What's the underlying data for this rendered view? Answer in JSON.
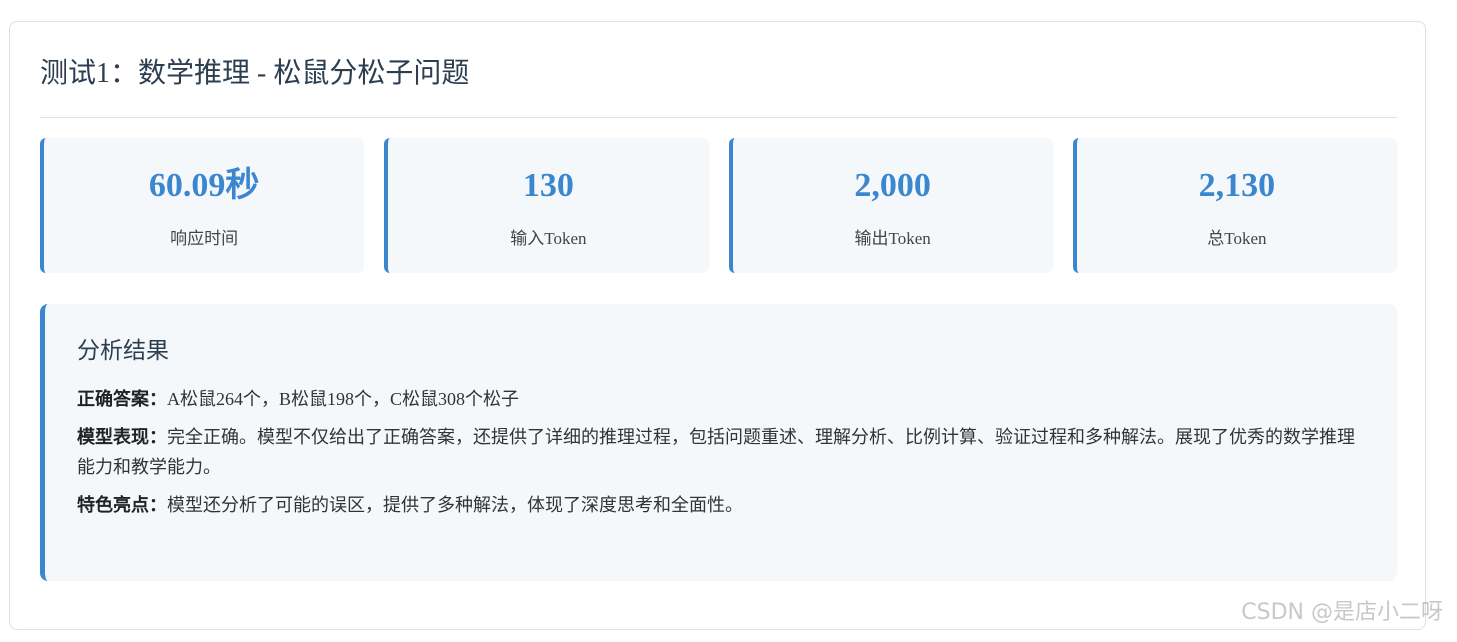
{
  "test": {
    "title": "测试1：数学推理 - 松鼠分松子问题"
  },
  "stats": [
    {
      "value": "60.09秒",
      "label": "响应时间"
    },
    {
      "value": "130",
      "label": "输入Token"
    },
    {
      "value": "2,000",
      "label": "输出Token"
    },
    {
      "value": "2,130",
      "label": "总Token"
    }
  ],
  "analysis": {
    "title": "分析结果",
    "items": [
      {
        "key": "正确答案：",
        "text": "A松鼠264个，B松鼠198个，C松鼠308个松子"
      },
      {
        "key": "模型表现：",
        "text": "完全正确。模型不仅给出了正确答案，还提供了详细的推理过程，包括问题重述、理解分析、比例计算、验证过程和多种解法。展现了优秀的数学推理能力和教学能力。"
      },
      {
        "key": "特色亮点：",
        "text": "模型还分析了可能的误区，提供了多种解法，体现了深度思考和全面性。"
      }
    ]
  },
  "watermark": "CSDN @是店小二呀",
  "colors": {
    "accent": "#3a86cf",
    "card_bg": "#f5f8fb",
    "title": "#2c3e50"
  }
}
